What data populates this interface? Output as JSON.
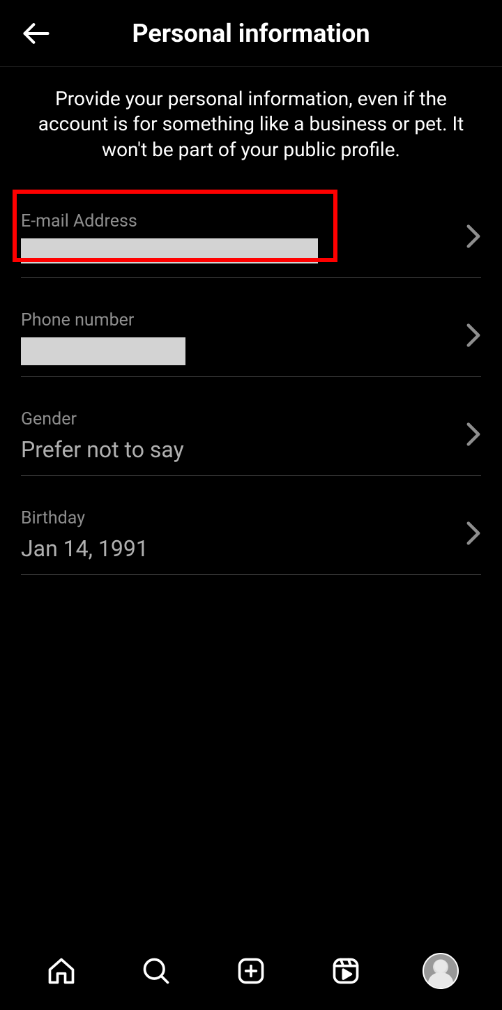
{
  "header": {
    "title": "Personal information"
  },
  "description": "Provide your personal information, even if the account is for something like a business or pet. It won't be part of your public profile.",
  "fields": {
    "email": {
      "label": "E-mail Address",
      "value": ""
    },
    "phone": {
      "label": "Phone number",
      "value": ""
    },
    "gender": {
      "label": "Gender",
      "value": "Prefer not to say"
    },
    "birthday": {
      "label": "Birthday",
      "value": "Jan 14, 1991"
    }
  }
}
